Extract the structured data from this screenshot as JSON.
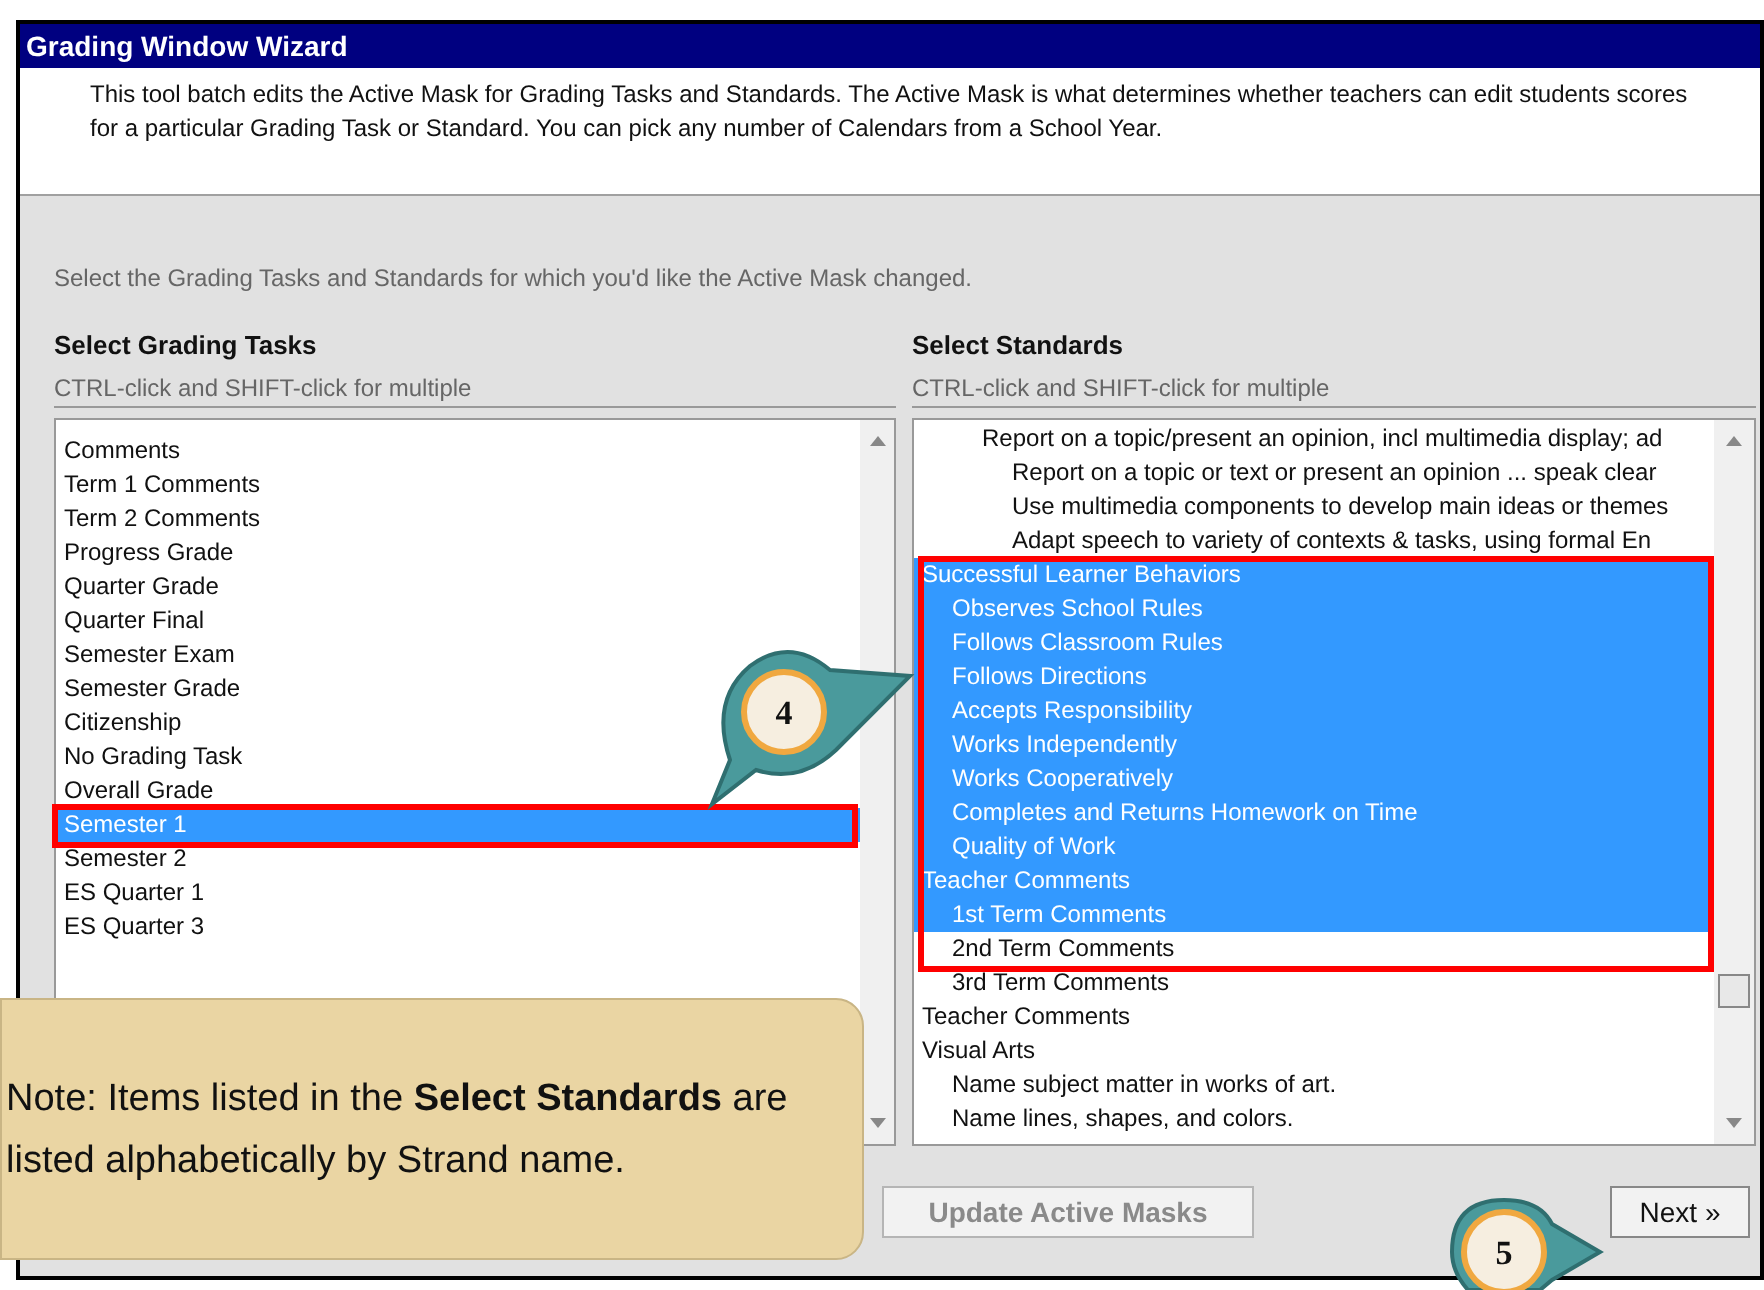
{
  "window": {
    "title": "Grading Window Wizard"
  },
  "description": "This tool batch edits the Active Mask for Grading Tasks and Standards. The Active Mask is what determines whether teachers can edit students scores for a particular Grading Task or Standard. You can pick any number of Calendars from a School Year.",
  "instruction": "Select the Grading Tasks and Standards for which you'd like the Active Mask changed.",
  "grading_tasks": {
    "heading": "Select Grading Tasks",
    "hint": "CTRL-click and SHIFT-click for multiple",
    "items": [
      {
        "label": "Comments",
        "selected": false
      },
      {
        "label": "Term 1 Comments",
        "selected": false
      },
      {
        "label": "Term 2 Comments",
        "selected": false
      },
      {
        "label": "Progress Grade",
        "selected": false
      },
      {
        "label": "Quarter Grade",
        "selected": false
      },
      {
        "label": "Quarter Final",
        "selected": false
      },
      {
        "label": "Semester Exam",
        "selected": false
      },
      {
        "label": "Semester Grade",
        "selected": false
      },
      {
        "label": "Citizenship",
        "selected": false
      },
      {
        "label": "No Grading Task",
        "selected": false
      },
      {
        "label": "Overall Grade",
        "selected": false
      },
      {
        "label": "Semester 1",
        "selected": true
      },
      {
        "label": "Semester 2",
        "selected": false
      },
      {
        "label": "ES Quarter 1",
        "selected": false
      },
      {
        "label": "ES Quarter 3",
        "selected": false
      }
    ]
  },
  "standards": {
    "heading": "Select Standards",
    "hint": "CTRL-click and SHIFT-click for multiple",
    "items": [
      {
        "kind": "continued",
        "label": "Report on a topic/present an opinion, incl multimedia display; ad",
        "selected": false,
        "children": [
          {
            "label": "Report on a topic or text or present an opinion ... speak clear",
            "selected": false
          },
          {
            "label": "Use multimedia components to develop main ideas or themes",
            "selected": false
          },
          {
            "label": "Adapt speech to variety of contexts & tasks, using formal En",
            "selected": false
          }
        ]
      },
      {
        "label": "Successful Learner Behaviors",
        "selected": true,
        "children": [
          {
            "label": "Observes School Rules",
            "selected": true
          },
          {
            "label": "Follows Classroom Rules",
            "selected": true
          },
          {
            "label": "Follows Directions",
            "selected": true
          },
          {
            "label": "Accepts Responsibility",
            "selected": true
          },
          {
            "label": "Works Independently",
            "selected": true
          },
          {
            "label": "Works Cooperatively",
            "selected": true
          },
          {
            "label": "Completes and Returns Homework on Time",
            "selected": true
          },
          {
            "label": "Quality of Work",
            "selected": true
          }
        ]
      },
      {
        "label": "Teacher Comments",
        "selected": true,
        "children": [
          {
            "label": "1st Term Comments",
            "selected": true
          },
          {
            "label": "2nd Term Comments",
            "selected": false
          },
          {
            "label": "3rd Term Comments",
            "selected": false
          }
        ]
      },
      {
        "label": "Teacher Comments",
        "selected": false
      },
      {
        "label": "Visual Arts",
        "selected": false,
        "children": [
          {
            "label": "Name subject matter in works of art.",
            "selected": false
          },
          {
            "label": "Name lines, shapes, and colors.",
            "selected": false
          }
        ]
      }
    ]
  },
  "buttons": [
    {
      "label": "Update Active Masks",
      "disabled": true
    },
    {
      "label": "Next »",
      "disabled": false
    }
  ],
  "callouts": [
    {
      "number": "4"
    },
    {
      "number": "5"
    }
  ],
  "note": "Note:  Items listed in the **Select Standards** are listed alphabetically by Strand name."
}
